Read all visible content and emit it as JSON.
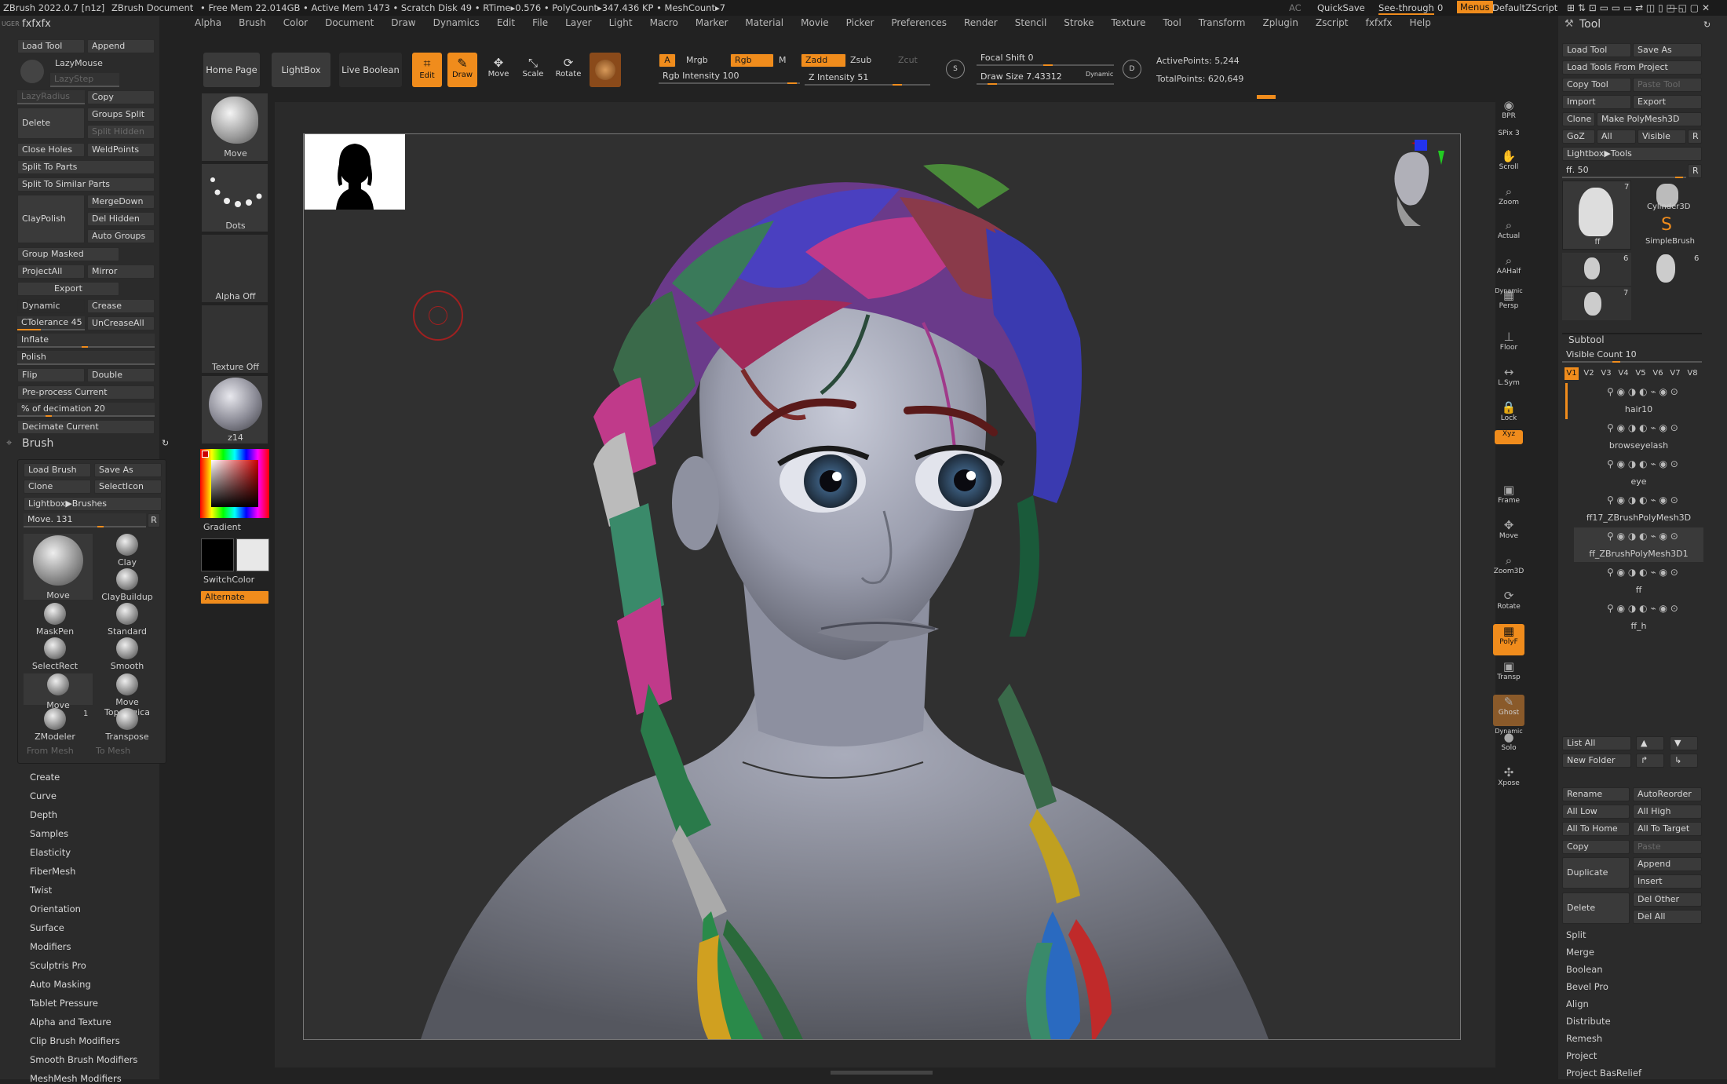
{
  "titlebar": {
    "app": "ZBrush 2022.0.7 [n1z]",
    "doc": "ZBrush Document",
    "stats": "• Free Mem 22.014GB • Active Mem 1473 • Scratch Disk 49 • RTime▸0.576 • PolyCount▸347.436 KP • MeshCount▸7",
    "ac": "AC",
    "quicksave": "QuickSave",
    "seethrough": "See-through",
    "seethrough_val": "0",
    "menus": "Menus",
    "script": "DefaultZScript"
  },
  "menus": [
    "Alpha",
    "Brush",
    "Color",
    "Document",
    "Draw",
    "Dynamics",
    "Edit",
    "File",
    "Layer",
    "Light",
    "Macro",
    "Marker",
    "Material",
    "Movie",
    "Picker",
    "Preferences",
    "Render",
    "Stencil",
    "Stroke",
    "Texture",
    "Tool",
    "Transform",
    "Zplugin",
    "Zscript",
    "fxfxfx",
    "Help"
  ],
  "left": {
    "header_small": "UGER",
    "header": "fxfxfx",
    "load_tool": "Load Tool",
    "append": "Append",
    "lazymouse": "LazyMouse",
    "lazystep": "LazyStep",
    "lazyradius": "LazyRadius",
    "copy": "Copy",
    "delete": "Delete",
    "groups_split": "Groups Split",
    "split_hidden": "Split Hidden",
    "close_holes": "Close Holes",
    "weldpoints": "WeldPoints",
    "split_to_parts": "Split To Parts",
    "split_similar": "Split To Similar Parts",
    "mergedown": "MergeDown",
    "claypolish": "ClayPolish",
    "del_hidden": "Del Hidden",
    "auto_groups": "Auto Groups",
    "group_masked": "Group Masked",
    "projectall": "ProjectAll",
    "mirror": "Mirror",
    "export": "Export",
    "dynamic": "Dynamic",
    "crease": "Crease",
    "ctolerance": "CTolerance 45",
    "uncreaseall": "UnCreaseAll",
    "inflate": "Inflate",
    "polish": "Polish",
    "flip": "Flip",
    "double": "Double",
    "preprocess": "Pre-process Current",
    "decimation": "% of decimation",
    "decimation_val": "20",
    "decimate": "Decimate Current"
  },
  "brush": {
    "title": "Brush",
    "load": "Load Brush",
    "save_as": "Save As",
    "clone": "Clone",
    "selecticon": "SelectIcon",
    "lightbox": "Lightbox▶Brushes",
    "current": "Move. 131",
    "r": "R",
    "items": [
      "Move",
      "Clay",
      "ClayBuildup",
      "MaskPen",
      "Standard",
      "SelectRect",
      "Smooth",
      "Move",
      "Move Topologica",
      "ZModeler",
      "Transpose"
    ],
    "zmodeler_count": "1",
    "from_mesh": "From Mesh",
    "to_mesh": "To Mesh",
    "sections": [
      "Create",
      "Curve",
      "Depth",
      "Samples",
      "Elasticity",
      "FiberMesh",
      "Twist",
      "Orientation",
      "Surface",
      "Modifiers",
      "Sculptris Pro",
      "Auto Masking",
      "Tablet Pressure",
      "Alpha and Texture",
      "Clip Brush Modifiers",
      "Smooth Brush Modifiers",
      "MeshMesh Modifiers"
    ]
  },
  "col2": {
    "move": "Move",
    "dots": "Dots",
    "alpha_off": "Alpha Off",
    "texture_off": "Texture Off",
    "material": "z14",
    "gradient": "Gradient",
    "switchcolor": "SwitchColor",
    "alternate": "Alternate"
  },
  "toolbar": {
    "home": "Home Page",
    "lightbox": "LightBox",
    "live_boolean": "Live Boolean",
    "edit": "Edit",
    "draw": "Draw",
    "move": "Move",
    "scale": "Scale",
    "rotate": "Rotate",
    "a": "A",
    "mrgb": "Mrgb",
    "rgb": "Rgb",
    "m": "M",
    "zadd": "Zadd",
    "zsub": "Zsub",
    "zcut": "Zcut",
    "rgb_intensity": "Rgb Intensity 100",
    "z_intensity": "Z Intensity 51",
    "focal_shift": "Focal Shift 0",
    "draw_size": "Draw Size 7.43312",
    "dynamic": "Dynamic",
    "active_points": "ActivePoints: 5,244",
    "total_points": "TotalPoints: 620,649"
  },
  "shelf": [
    "BPR",
    "SPix 3",
    "Scroll",
    "Zoom",
    "Actual",
    "AAHalf",
    "Persp",
    "Floor",
    "L.Sym",
    "Lock",
    "Xyz",
    "Frame",
    "Move",
    "Zoom3D",
    "Rotate",
    "PolyF",
    "Transp",
    "Ghost",
    "Solo",
    "Xpose"
  ],
  "shelf_extra": {
    "dynamic": "Dynamic"
  },
  "right": {
    "title": "Tool",
    "load_tool": "Load Tool",
    "save_as": "Save As",
    "load_from_project": "Load Tools From Project",
    "copy_tool": "Copy Tool",
    "paste_tool": "Paste Tool",
    "import": "Import",
    "export": "Export",
    "clone": "Clone",
    "make_polymesh": "Make PolyMesh3D",
    "goz": "GoZ",
    "all": "All",
    "visible": "Visible",
    "r": "R",
    "lightbox_tools": "Lightbox▶Tools",
    "ff_slider": "ff. 50",
    "tool_ff": "ff",
    "tool_ff_count": "7",
    "cylinder": "Cylinder3D",
    "simplebrush": "SimpleBrush",
    "count6a": "6",
    "count6b": "6",
    "count7": "7",
    "subtool": "Subtool",
    "visible_count": "Visible Count 10",
    "versions": [
      "V1",
      "V2",
      "V3",
      "V4",
      "V5",
      "V6",
      "V7",
      "V8"
    ],
    "subtools": [
      "hair10",
      "browseyelash",
      "eye",
      "ff17_ZBrushPolyMesh3D",
      "ff_ZBrushPolyMesh3D1",
      "ff",
      "ff_h"
    ],
    "list_all": "List All",
    "new_folder": "New Folder",
    "rename": "Rename",
    "autoreorder": "AutoReorder",
    "all_low": "All Low",
    "all_high": "All High",
    "all_to_home": "All To Home",
    "all_to_target": "All To Target",
    "copy": "Copy",
    "paste": "Paste",
    "append": "Append",
    "duplicate": "Duplicate",
    "insert": "Insert",
    "delete": "Delete",
    "del_other": "Del Other",
    "del_all": "Del All",
    "list": [
      "Split",
      "Merge",
      "Boolean",
      "Bevel Pro",
      "Align",
      "Distribute",
      "Remesh",
      "Project",
      "Project BasRelief"
    ]
  },
  "colors": {
    "accent": "#f08c1c",
    "panel": "#2b2b2b",
    "button": "#3a3a3a"
  }
}
